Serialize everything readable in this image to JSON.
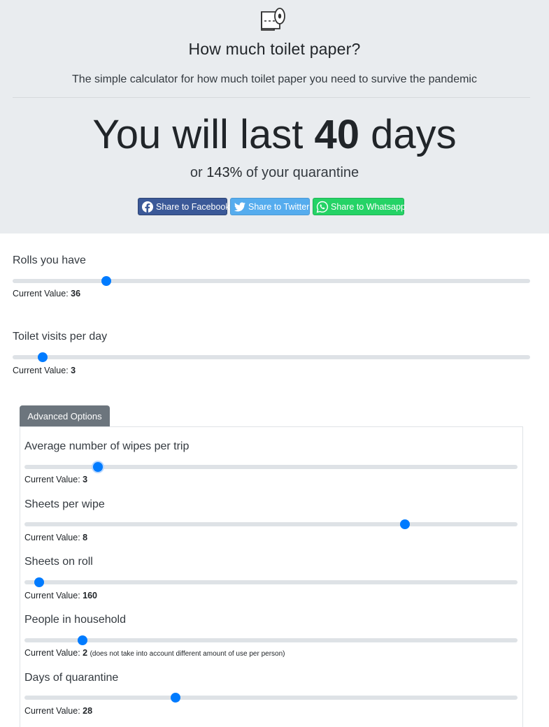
{
  "hero": {
    "logo_icon": "toilet-paper-roll-icon",
    "title": "How much toilet paper?",
    "lead": "The simple calculator for how much toilet paper you need to survive the pandemic",
    "result_prefix": "You will last ",
    "result_days": "40",
    "result_suffix": " days",
    "sub_prefix": "or ",
    "sub_percent": "143%",
    "sub_suffix": " of your quarantine"
  },
  "share": [
    {
      "label": "Share to Facebook",
      "icon": "facebook-icon",
      "color": "#3b5998"
    },
    {
      "label": "Share to Twitter",
      "icon": "twitter-icon",
      "color": "#55acee"
    },
    {
      "label": "Share to Whatsapp",
      "icon": "whatsapp-icon",
      "color": "#25d366"
    }
  ],
  "current_value_label": "Current Value: ",
  "accent_color": "#007bff",
  "sliders": {
    "rolls": {
      "label": "Rolls you have",
      "value": "36",
      "fraction": 0.181
    },
    "visits": {
      "label": "Toilet visits per day",
      "value": "3",
      "fraction": 0.058
    }
  },
  "advanced": {
    "button_label": "Advanced Options",
    "sliders": {
      "wipes": {
        "label": "Average number of wipes per trip",
        "value": "3",
        "fraction": 0.149
      },
      "sheets_per_wipe": {
        "label": "Sheets per wipe",
        "value": "8",
        "fraction": 0.772
      },
      "sheets_on_roll": {
        "label": "Sheets on roll",
        "value": "160",
        "fraction": 0.03
      },
      "people": {
        "label": "People in household",
        "value": "2",
        "note": "(does not take into account different amount of use per person)",
        "fraction": 0.118
      },
      "days": {
        "label": "Days of quarantine",
        "value": "28",
        "fraction": 0.307
      }
    }
  }
}
